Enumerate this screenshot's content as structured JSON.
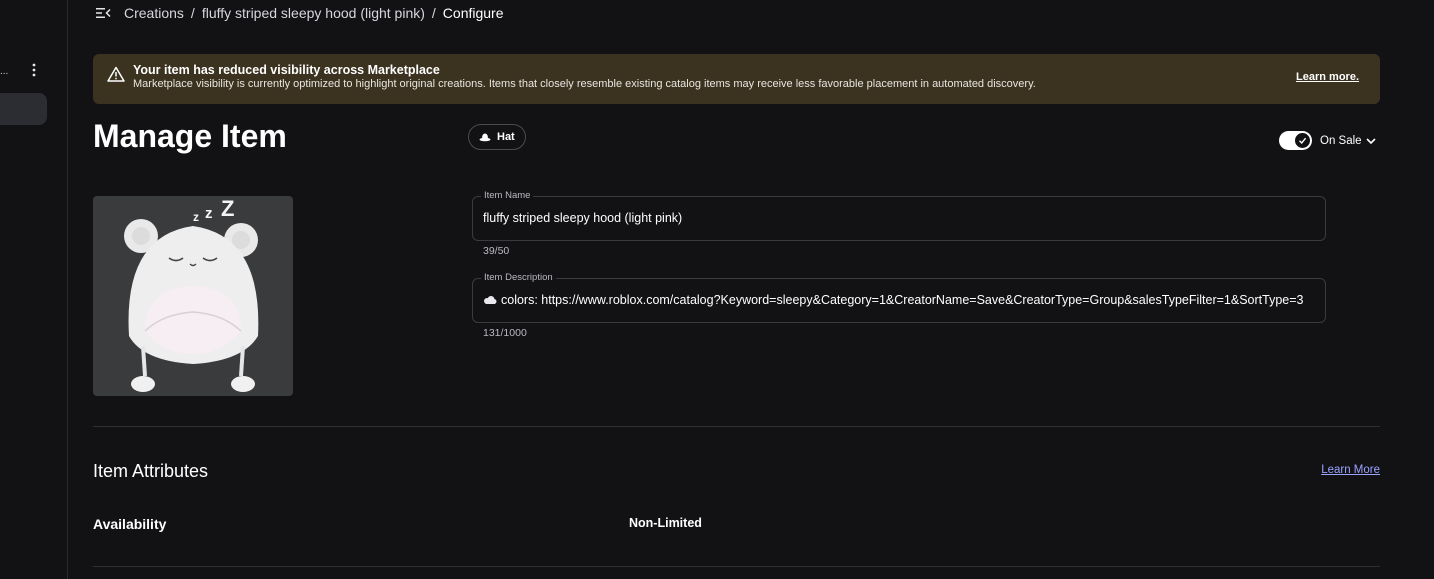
{
  "breadcrumb": {
    "items": [
      "Creations",
      "fluffy striped sleepy hood (light pink)"
    ],
    "current": "Configure",
    "separator": "/"
  },
  "sidebar": {
    "overflow_text": "..."
  },
  "banner": {
    "title": "Your item has reduced visibility across Marketplace",
    "text": "Marketplace visibility is currently optimized to highlight original creations. Items that closely resemble existing catalog items may receive less favorable placement in automated discovery.",
    "link": "Learn more.",
    "color": "#3b3220"
  },
  "page": {
    "title": "Manage Item",
    "type_chip": "Hat",
    "sale_status": "On Sale",
    "sale_toggle_on": true
  },
  "fields": {
    "name": {
      "label": "Item Name",
      "value": "fluffy striped sleepy hood (light pink)",
      "counter": "39/50"
    },
    "description": {
      "label": "Item Description",
      "value": "colors: https://www.roblox.com/catalog?Keyword=sleepy&Category=1&CreatorName=Save&CreatorType=Group&salesTypeFilter=1&SortType=3",
      "counter": "131/1000"
    }
  },
  "attributes": {
    "title": "Item Attributes",
    "learn_more": "Learn More",
    "rows": [
      {
        "label": "Availability",
        "value": "Non-Limited"
      }
    ]
  },
  "colors": {
    "background": "#121215",
    "link": "#9aa3ff"
  },
  "icons": [
    "sidebar-collapse-icon",
    "kebab-menu-icon",
    "warning-icon",
    "hat-icon",
    "check-icon",
    "chevron-down-icon",
    "cloud-emoji-icon"
  ]
}
